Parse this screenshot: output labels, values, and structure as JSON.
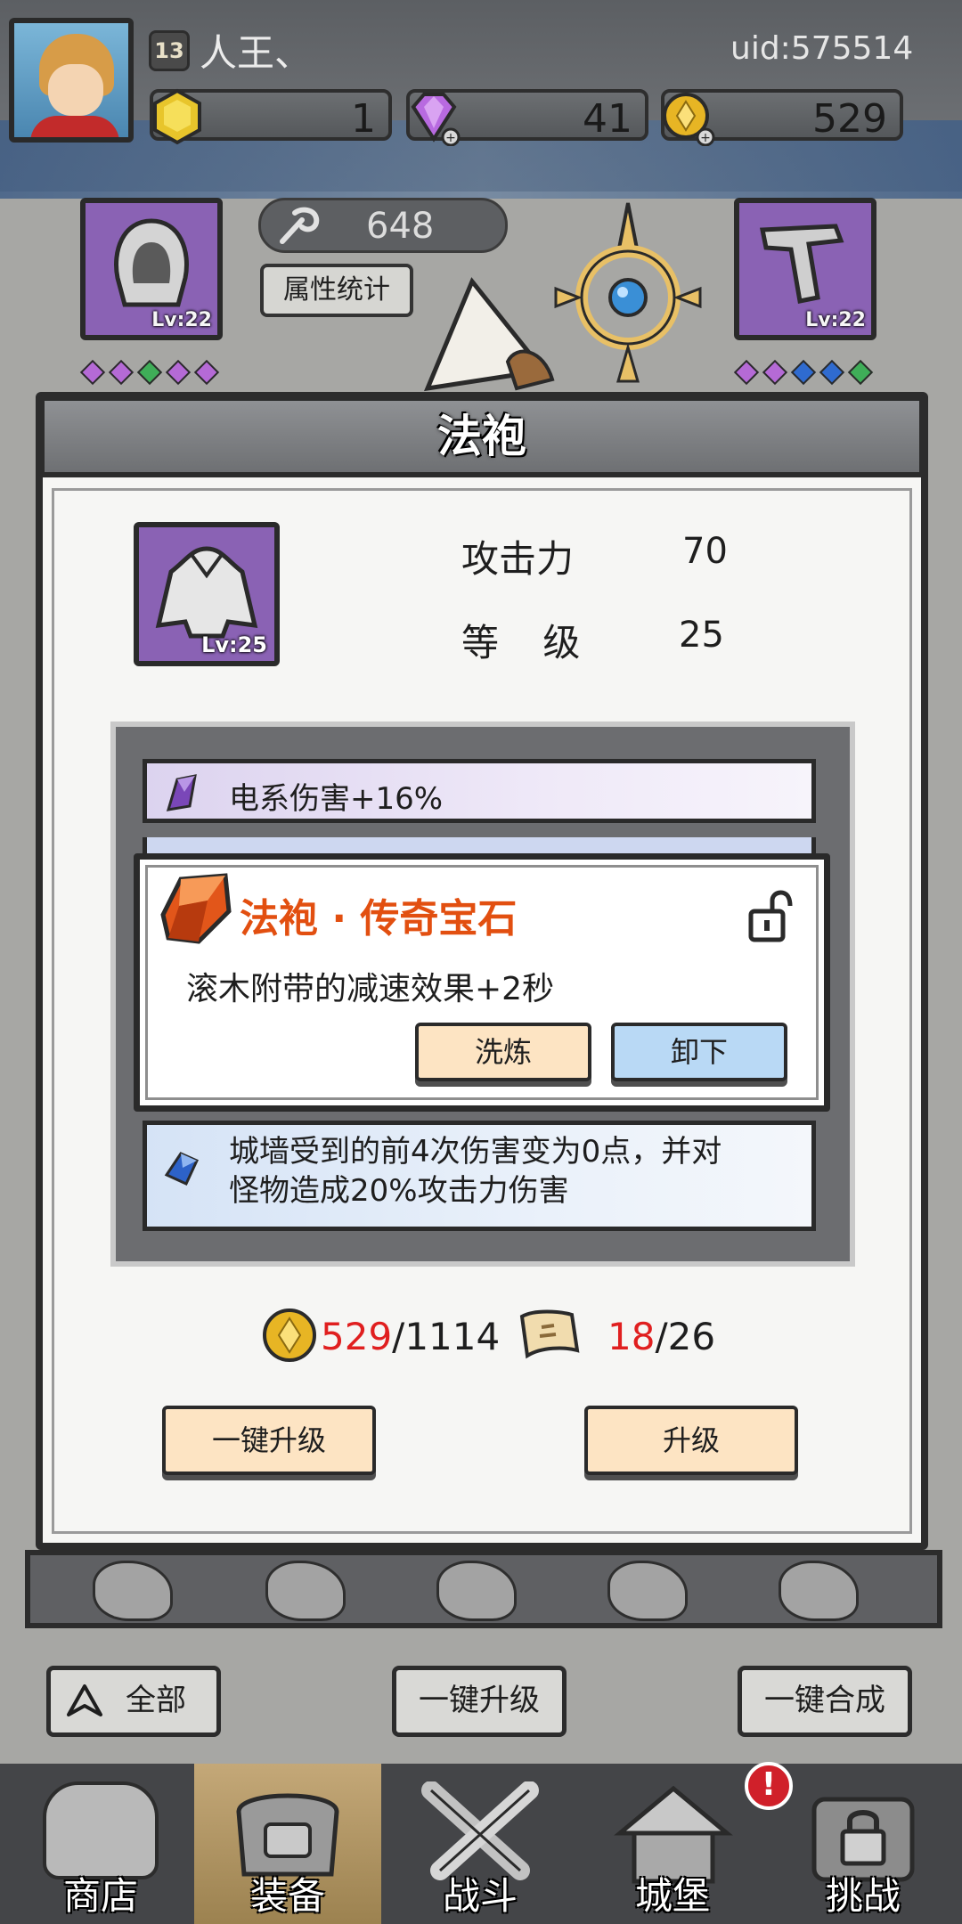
{
  "header": {
    "level": "13",
    "player_name": "人王、",
    "uid": "uid:575514",
    "resources": [
      {
        "icon": "hex-gem-icon",
        "value": "1"
      },
      {
        "icon": "purple-diamond-icon",
        "value": "41"
      },
      {
        "icon": "gold-coin-icon",
        "value": "529"
      }
    ]
  },
  "character": {
    "left_slot_level": "Lv:22",
    "right_slot_level": "Lv:22",
    "power": "648",
    "stats_button": "属性统计"
  },
  "modal": {
    "title": "法袍",
    "item_level": "Lv:25",
    "attack_label": "攻击力",
    "attack_value": "70",
    "level_label": "等 级",
    "level_value": "25",
    "bonus_top": "电系伤害+16%",
    "gem_card": {
      "title": "法袍 · 传奇宝石",
      "description": "滚木附带的减速效果+2秒",
      "refine_button": "洗炼",
      "remove_button": "卸下"
    },
    "bonus_bottom_line1": "城墙受到的前4次伤害变为0点，并对",
    "bonus_bottom_line2": "怪物造成20%攻击力伤害",
    "gold_cost_have": "529",
    "gold_cost_need": "/1114",
    "scroll_cost_have": "18",
    "scroll_cost_need": "/26",
    "quick_upgrade_button": "一键升级",
    "upgrade_button": "升级"
  },
  "actions": {
    "filter_all": "全部",
    "quick_upgrade_all": "一键升级",
    "quick_merge": "一键合成"
  },
  "nav": [
    {
      "label": "商店"
    },
    {
      "label": "装备"
    },
    {
      "label": "战斗"
    },
    {
      "label": "城堡"
    },
    {
      "label": "挑战"
    }
  ],
  "alert_badge": "!",
  "colors": {
    "item_purple": "#8a62b4",
    "gem_title_orange": "#e24f10",
    "cost_red": "#e01f1f",
    "button_beige": "#fde4c3",
    "button_blue": "#b9d9f5"
  }
}
